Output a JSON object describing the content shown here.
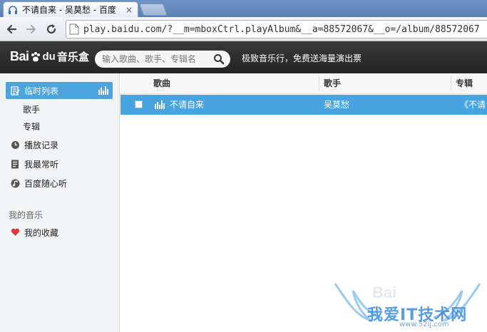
{
  "browser": {
    "tab_title": "不请自来 - 吴莫愁 - 百度",
    "tab_close": "×",
    "url": "play.baidu.com/?__m=mboxCtrl.playAlbum&__a=88572067&__o=/album/88572067"
  },
  "header": {
    "logo_bai": "Bai",
    "logo_du": "du",
    "logo_music": "音乐盒",
    "search_placeholder": "输入歌曲、歌手、专辑名",
    "promo": "极致音乐行，免费送海量演出票"
  },
  "sidebar": {
    "items": [
      {
        "label": "临时列表",
        "icon": "list-edit-icon",
        "active": true
      },
      {
        "label": "歌手",
        "icon": "",
        "active": false
      },
      {
        "label": "专辑",
        "icon": "",
        "active": false
      },
      {
        "label": "播放记录",
        "icon": "history-icon",
        "active": false
      },
      {
        "label": "我最常听",
        "icon": "document-icon",
        "active": false
      },
      {
        "label": "百度随心听",
        "icon": "music-note-icon",
        "active": false
      }
    ],
    "section_heading": "我的音乐",
    "favorites": {
      "label": "我的收藏",
      "icon": "heart-icon"
    }
  },
  "table": {
    "columns": [
      "歌曲",
      "歌手",
      "专辑"
    ],
    "rows": [
      {
        "song": "不请自来",
        "artist": "吴莫愁",
        "album": "《不请"
      }
    ]
  },
  "watermark": {
    "main": "我爱IT技术网",
    "sub": "www.52ij.com",
    "faint": "Bai"
  },
  "colors": {
    "header_bg": "#2b2b2b",
    "accent": "#48a4e0",
    "sidebar_bg": "#f3f4f6"
  }
}
